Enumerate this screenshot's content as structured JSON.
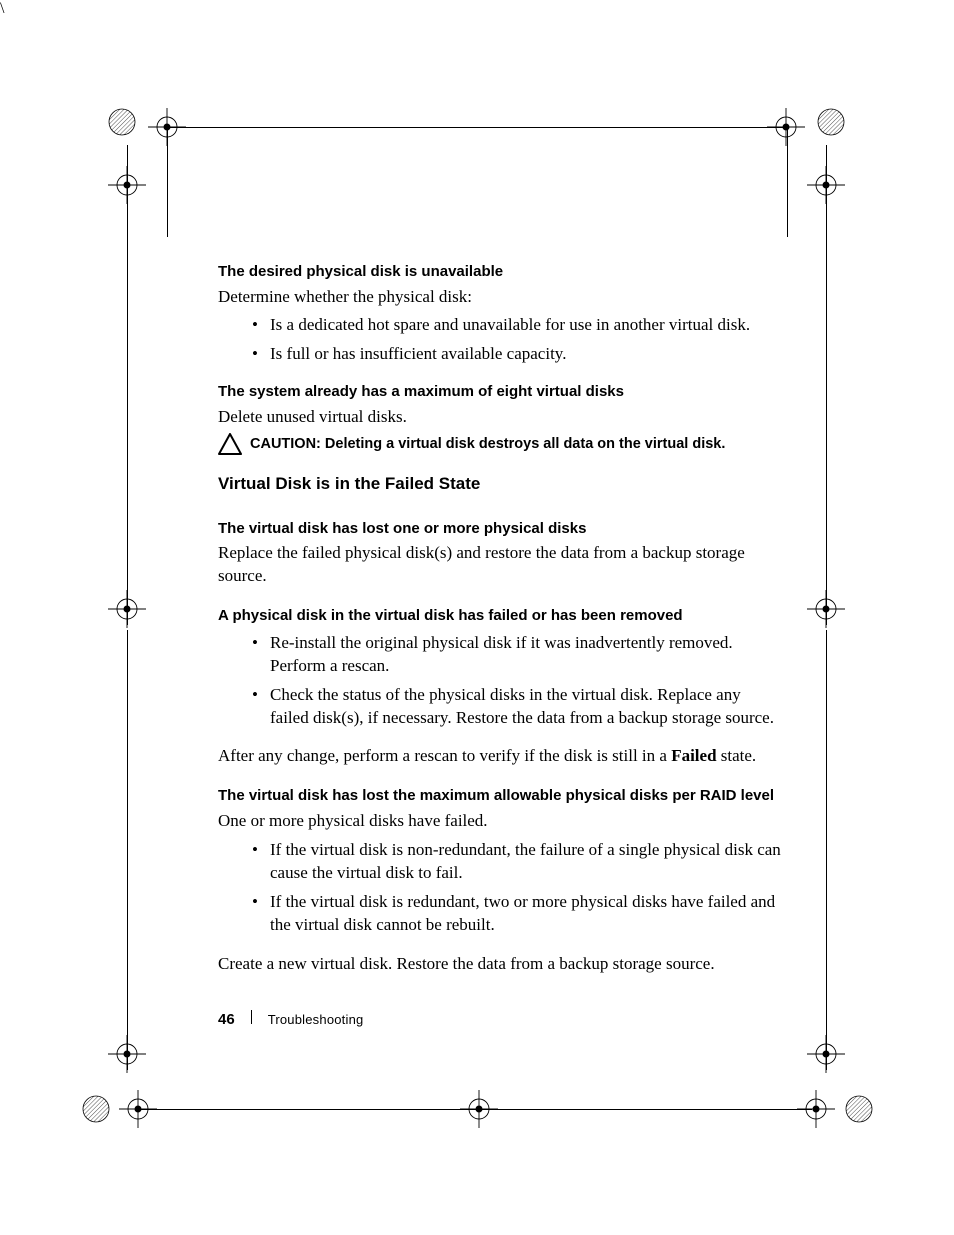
{
  "footer": {
    "page_number": "46",
    "section": "Troubleshooting"
  },
  "sections": {
    "s1": {
      "heading": "The desired physical disk is unavailable",
      "intro": "Determine whether the physical disk:",
      "bullets": [
        "Is a dedicated hot spare and unavailable for use in another virtual disk.",
        "Is full or has insufficient available capacity."
      ]
    },
    "s2": {
      "heading": "The system already has a maximum of eight virtual disks",
      "body": "Delete unused virtual disks.",
      "caution_label": "CAUTION:",
      "caution_text": " Deleting a virtual disk destroys all data on the virtual disk."
    },
    "s3": {
      "heading": "Virtual Disk is in the Failed State"
    },
    "s4": {
      "heading": "The virtual disk has lost one or more physical disks",
      "body": "Replace the failed physical disk(s) and restore the data from a backup storage source."
    },
    "s5": {
      "heading": "A physical disk in the virtual disk has failed or has been removed",
      "bullets": [
        "Re-install the original physical disk if it was inadvertently removed. Perform a rescan.",
        "Check the status of the physical disks in the virtual disk. Replace any failed disk(s), if necessary. Restore the data from a backup storage source."
      ],
      "after_pre": "After any change, perform a rescan to verify if the disk is still in a ",
      "after_bold": "Failed",
      "after_post": " state."
    },
    "s6": {
      "heading": "The virtual disk has lost the maximum allowable physical disks per RAID level",
      "intro": "One or more physical disks have failed.",
      "bullets": [
        "If the virtual disk is non-redundant, the failure of a single physical disk can cause the virtual disk to fail.",
        "If the virtual disk is redundant, two or more physical disks have failed and the virtual disk cannot be rebuilt."
      ],
      "after": "Create a new virtual disk. Restore the data from a backup storage source."
    }
  },
  "icons": {
    "caution": "caution-triangle-icon",
    "registration": "registration-mark-icon",
    "hatched_circle": "hatched-circle-icon"
  }
}
